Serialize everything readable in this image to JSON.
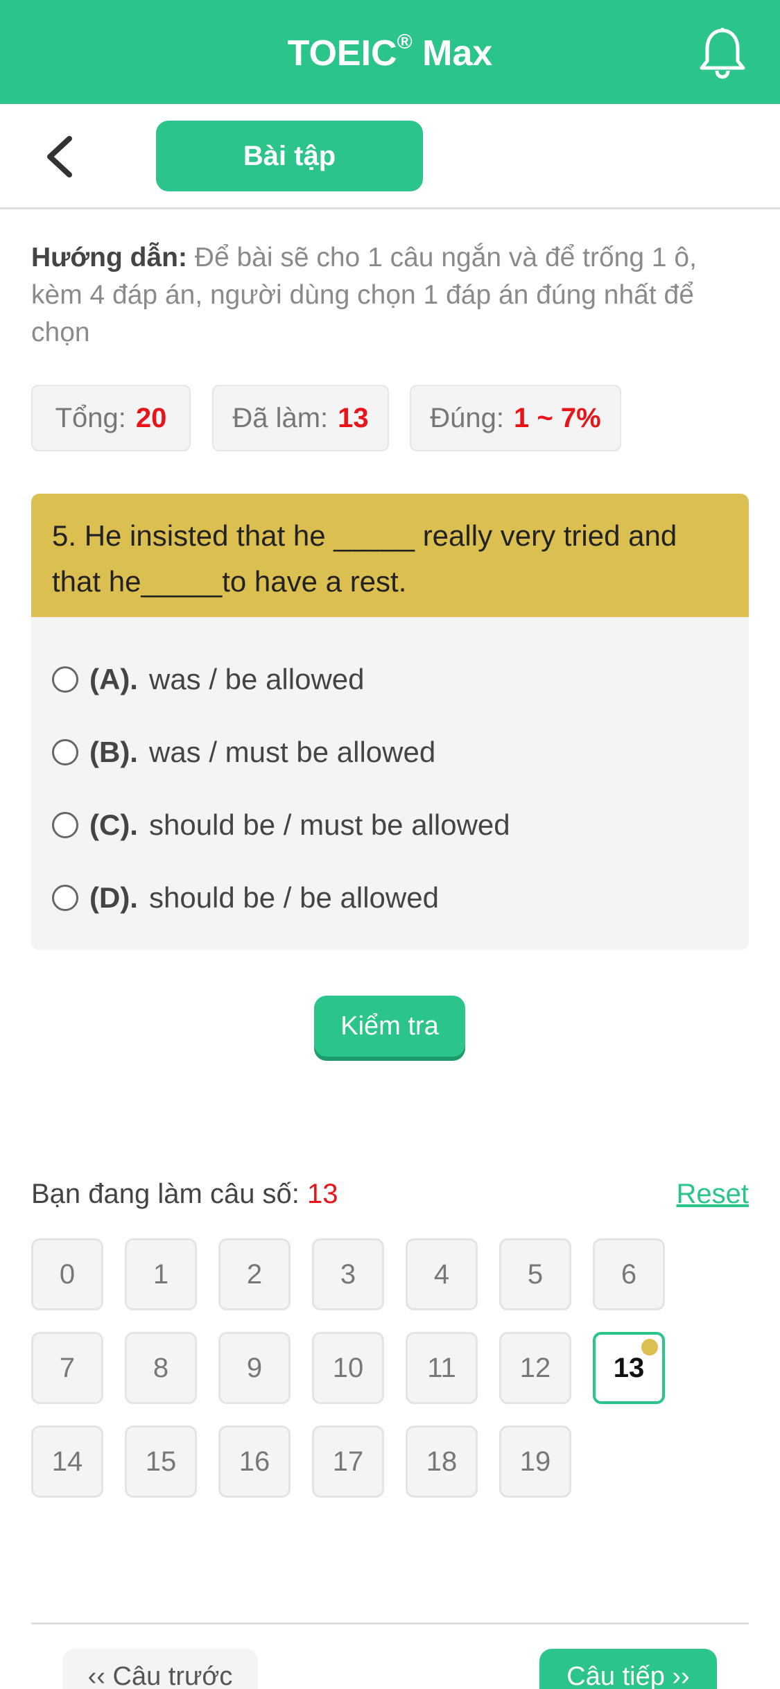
{
  "header": {
    "app_title": "TOEIC",
    "app_title_mark": "®",
    "app_title_suffix": " Max",
    "bell_icon": "bell-icon",
    "color": "#2bc48a"
  },
  "subheader": {
    "back_icon": "chevron-left-icon",
    "tab_label": "Bài tập"
  },
  "instructions": {
    "label": "Hướng dẫn:",
    "text": " Để bài sẽ cho 1 câu ngắn và để trống 1 ô, kèm 4 đáp án, người dùng chọn 1 đáp án đúng nhất để chọn"
  },
  "stats": [
    {
      "label": "Tổng:",
      "value": "20"
    },
    {
      "label": "Đã làm:",
      "value": "13"
    },
    {
      "label": "Đúng:",
      "value": "1 ~ 7%"
    }
  ],
  "question": {
    "text": "5. He insisted that he _____ really very tried and that he_____to have a rest.",
    "options": [
      {
        "label": "(A).",
        "text": "was / be allowed"
      },
      {
        "label": "(B).",
        "text": "was / must be allowed"
      },
      {
        "label": "(C).",
        "text": "should be / must be allowed"
      },
      {
        "label": "(D).",
        "text": "should be / be allowed"
      }
    ]
  },
  "check_button": "Kiểm tra",
  "progress": {
    "label": "Bạn đang làm câu số:",
    "current": "13",
    "reset": "Reset"
  },
  "grid": [
    "0",
    "1",
    "2",
    "3",
    "4",
    "5",
    "6",
    "7",
    "8",
    "9",
    "10",
    "11",
    "12",
    "13",
    "14",
    "15",
    "16",
    "17",
    "18",
    "19"
  ],
  "navigation": {
    "prev": "‹‹ Câu trước",
    "next": "Câu tiếp ››"
  }
}
